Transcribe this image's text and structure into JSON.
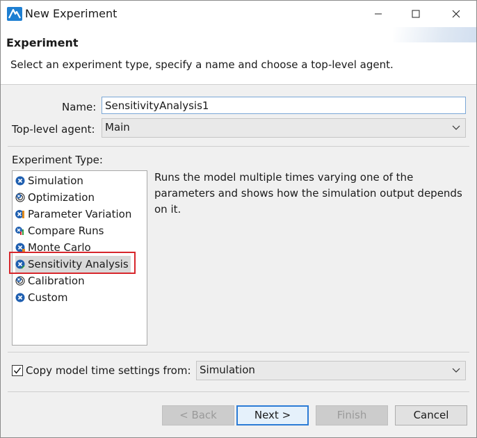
{
  "window": {
    "title": "New Experiment"
  },
  "header": {
    "title": "Experiment",
    "description": "Select an experiment type, specify a name and choose a top-level agent."
  },
  "form": {
    "name_label": "Name:",
    "name_value": "SensitivityAnalysis1",
    "agent_label": "Top-level agent:",
    "agent_value": "Main"
  },
  "experiment_types": {
    "label": "Experiment Type:",
    "items": [
      {
        "label": "Simulation",
        "icon": "simulation-icon"
      },
      {
        "label": "Optimization",
        "icon": "optimization-icon"
      },
      {
        "label": "Parameter Variation",
        "icon": "parameter-variation-icon"
      },
      {
        "label": "Compare Runs",
        "icon": "compare-runs-icon"
      },
      {
        "label": "Monte Carlo",
        "icon": "monte-carlo-icon"
      },
      {
        "label": "Sensitivity Analysis",
        "icon": "sensitivity-analysis-icon",
        "selected": true
      },
      {
        "label": "Calibration",
        "icon": "calibration-icon"
      },
      {
        "label": "Custom",
        "icon": "custom-icon"
      }
    ],
    "description": "Runs the model multiple times varying one of the parameters and shows how the simulation output depends on it."
  },
  "copy_settings": {
    "checked": true,
    "label": "Copy model time settings from:",
    "value": "Simulation"
  },
  "buttons": {
    "back": "< Back",
    "next": "Next >",
    "finish": "Finish",
    "cancel": "Cancel"
  },
  "colors": {
    "accent": "#2b7bd5",
    "highlight_outline": "#d7262b",
    "icon_blue": "#1f5fb0"
  }
}
